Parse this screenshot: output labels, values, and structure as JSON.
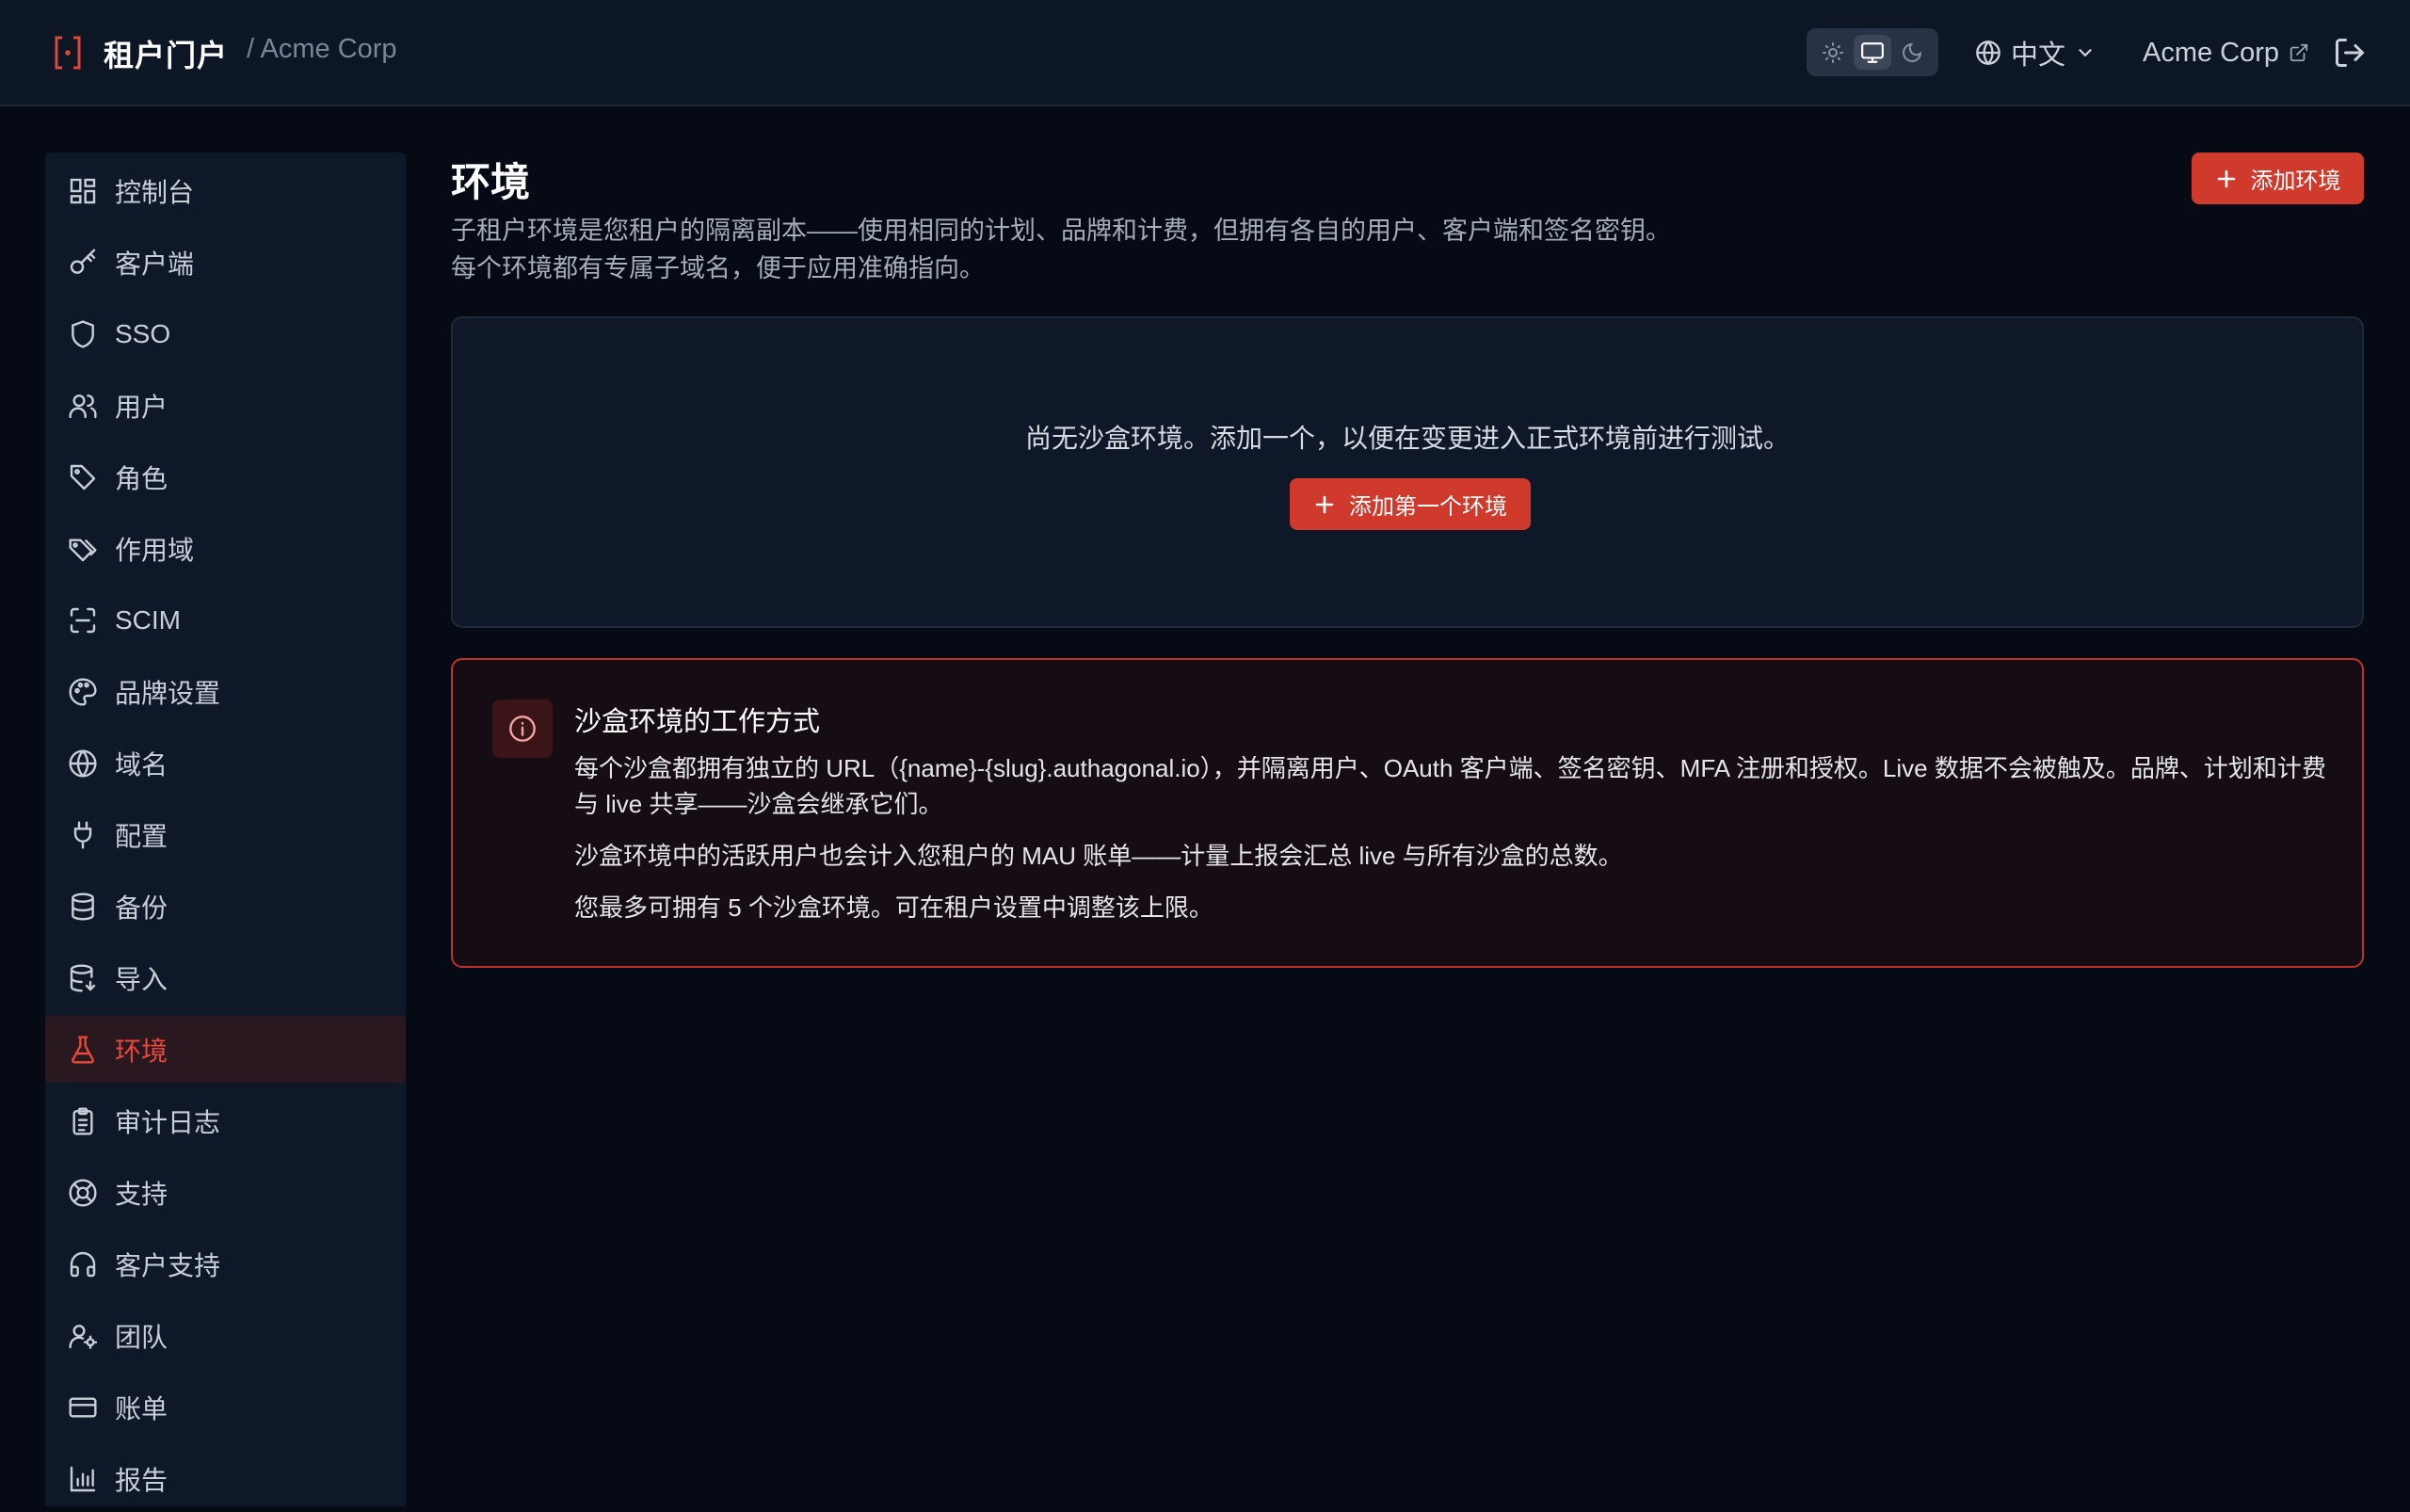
{
  "header": {
    "brand_title": "租户门户",
    "breadcrumb": "/ Acme Corp",
    "theme_modes": [
      "light",
      "system",
      "dark"
    ],
    "theme_active": "system",
    "language": "中文",
    "tenant_name": "Acme Corp"
  },
  "sidebar": {
    "items": [
      {
        "label": "控制台",
        "icon": "dashboard-icon"
      },
      {
        "label": "客户端",
        "icon": "key-icon"
      },
      {
        "label": "SSO",
        "icon": "shield-icon"
      },
      {
        "label": "用户",
        "icon": "users-icon"
      },
      {
        "label": "角色",
        "icon": "tag-icon"
      },
      {
        "label": "作用域",
        "icon": "tags-icon"
      },
      {
        "label": "SCIM",
        "icon": "scan-icon"
      },
      {
        "label": "品牌设置",
        "icon": "palette-icon"
      },
      {
        "label": "域名",
        "icon": "globe-icon"
      },
      {
        "label": "配置",
        "icon": "plug-icon"
      },
      {
        "label": "备份",
        "icon": "database-icon"
      },
      {
        "label": "导入",
        "icon": "database-import-icon"
      },
      {
        "label": "环境",
        "icon": "flask-icon",
        "active": true
      },
      {
        "label": "审计日志",
        "icon": "clipboard-icon"
      },
      {
        "label": "支持",
        "icon": "lifebuoy-icon"
      },
      {
        "label": "客户支持",
        "icon": "headphones-icon"
      },
      {
        "label": "团队",
        "icon": "user-cog-icon"
      },
      {
        "label": "账单",
        "icon": "credit-card-icon"
      },
      {
        "label": "报告",
        "icon": "bar-chart-icon"
      }
    ]
  },
  "main": {
    "title": "环境",
    "description_line1": "子租户环境是您租户的隔离副本——使用相同的计划、品牌和计费，但拥有各自的用户、客户端和签名密钥。",
    "description_line2": "每个环境都有专属子域名，便于应用准确指向。",
    "add_button": "添加环境",
    "empty_text": "尚无沙盒环境。添加一个，以便在变更进入正式环境前进行测试。",
    "add_first_button": "添加第一个环境"
  },
  "info": {
    "title": "沙盒环境的工作方式",
    "paragraph1": "每个沙盒都拥有独立的 URL（{name}-{slug}.authagonal.io），并隔离用户、OAuth 客户端、签名密钥、MFA 注册和授权。Live 数据不会被触及。品牌、计划和计费与 live 共享——沙盒会继承它们。",
    "paragraph2": "沙盒环境中的活跃用户也会计入您租户的 MAU 账单——计量上报会汇总 live 与所有沙盒的总数。",
    "paragraph3": "您最多可拥有 5 个沙盒环境。可在租户设置中调整该上限。"
  },
  "colors": {
    "accent": "#cf3a2d",
    "active_nav_text": "#e8483a",
    "background": "#050a14"
  }
}
